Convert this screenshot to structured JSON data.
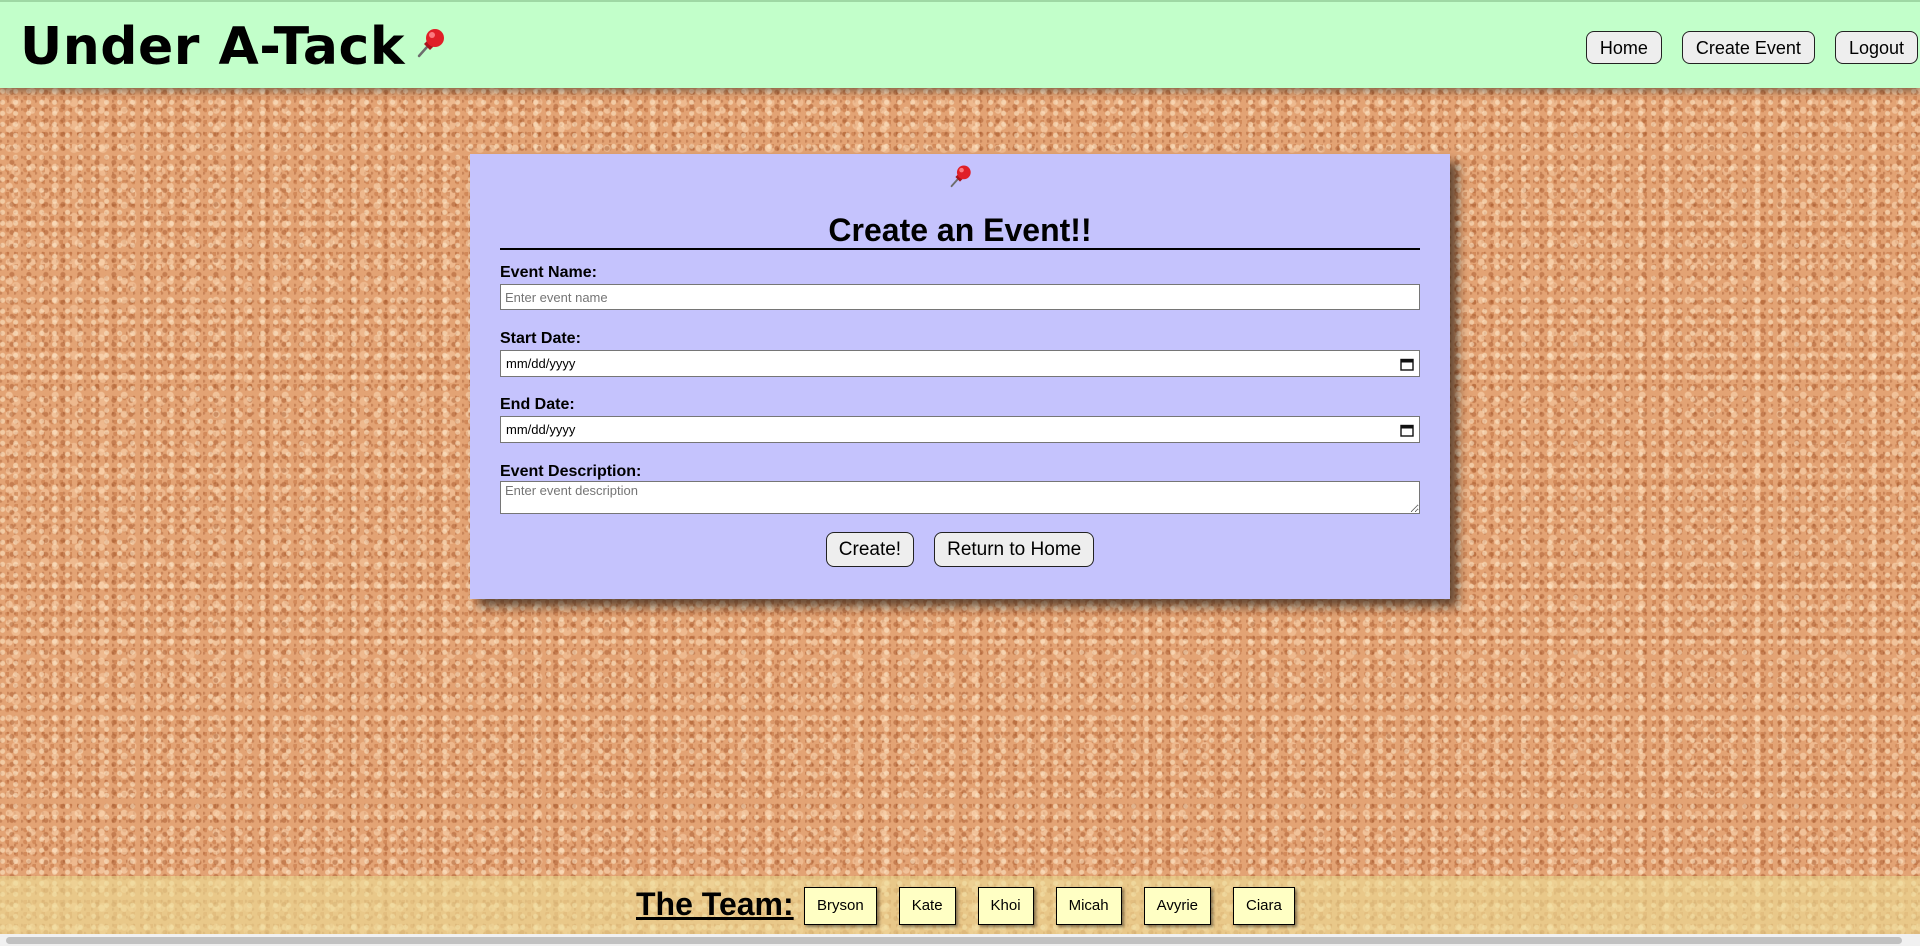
{
  "header": {
    "brand_title": "Under A-Tack",
    "brand_icon": "pushpin-icon",
    "nav": {
      "home_label": "Home",
      "create_event_label": "Create Event",
      "logout_label": "Logout"
    },
    "background_color": "#c2ffca"
  },
  "form": {
    "title": "Create an Event!!",
    "pin_icon": "pushpin-icon",
    "event_name": {
      "label": "Event Name:",
      "placeholder": "Enter event name",
      "value": ""
    },
    "start_date": {
      "label": "Start Date:",
      "display": "mm/dd/yyyy",
      "icon": "calendar-icon"
    },
    "end_date": {
      "label": "End Date:",
      "display": "mm/dd/yyyy",
      "icon": "calendar-icon"
    },
    "event_description": {
      "label": "Event Description:",
      "placeholder": "Enter event description",
      "value": ""
    },
    "create_label": "Create!",
    "return_label": "Return to Home",
    "background_color": "#c5c3fd"
  },
  "footer": {
    "team_label": "The Team:",
    "members": [
      "Bryson",
      "Kate",
      "Khoi",
      "Micah",
      "Avyrie",
      "Ciara"
    ],
    "badge_color": "#ffffc4"
  },
  "colors": {
    "cork": "#e3a374"
  }
}
